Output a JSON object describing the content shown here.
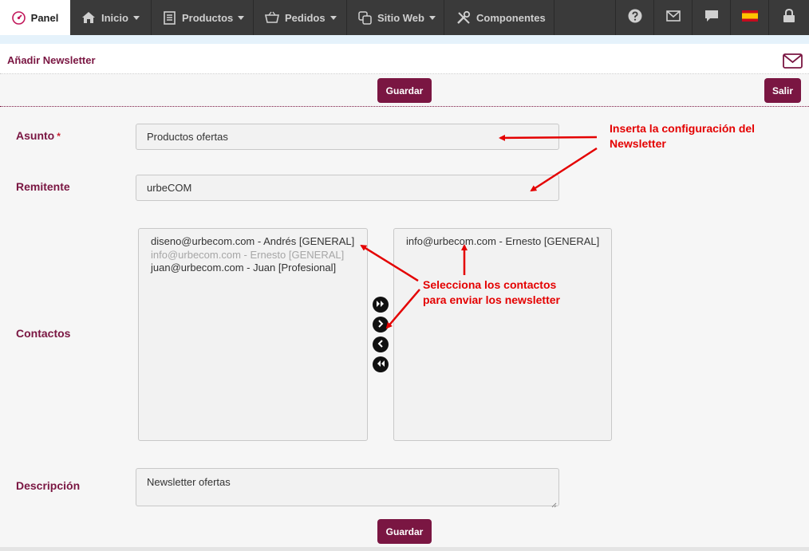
{
  "nav": {
    "panel": "Panel",
    "inicio": "Inicio",
    "productos": "Productos",
    "pedidos": "Pedidos",
    "sitio_web": "Sitio Web",
    "componentes": "Componentes",
    "right_icons": [
      "help-icon",
      "mail-icon",
      "chat-icon",
      "spain-flag-icon",
      "lock-icon"
    ]
  },
  "page": {
    "title": "Añadir Newsletter",
    "save_label": "Guardar",
    "exit_label": "Salir",
    "bottom_save_label": "Guardar"
  },
  "form": {
    "asunto": {
      "label": "Asunto",
      "required_mark": "*",
      "value": "Productos ofertas"
    },
    "remitente": {
      "label": "Remitente",
      "value": "urbeCOM"
    },
    "contactos": {
      "label": "Contactos",
      "available": [
        "diseno@urbecom.com - Andrés [GENERAL]",
        "info@urbecom.com - Ernesto [GENERAL]",
        "juan@urbecom.com - Juan [Profesional]"
      ],
      "selected": [
        "info@urbecom.com - Ernesto [GENERAL]"
      ]
    },
    "descripcion": {
      "label": "Descripción",
      "value": "Newsletter ofertas"
    }
  },
  "annotations": {
    "config_line1": "Inserta la configuración del",
    "config_line2": "Newsletter",
    "contacts_line1": "Selecciona los contactos",
    "contacts_line2": "para enviar los newsletter"
  },
  "colors": {
    "brand": "#7a1642",
    "annotation": "#e40000",
    "nav_bg": "#3a3a3a"
  }
}
